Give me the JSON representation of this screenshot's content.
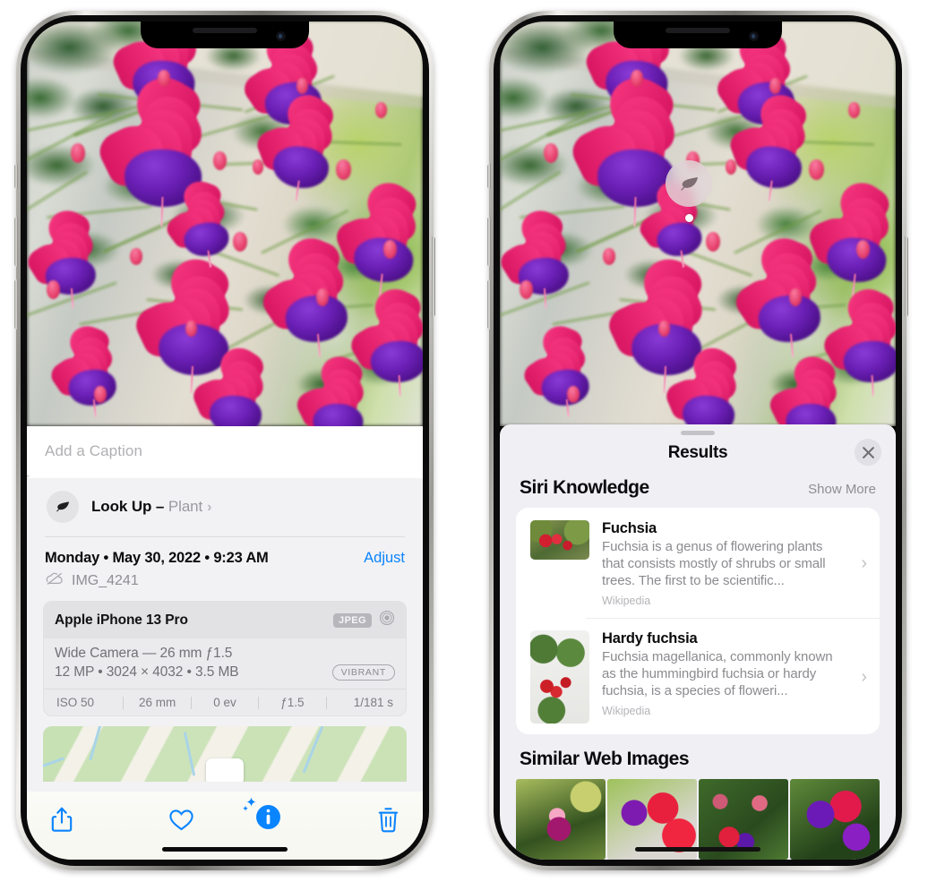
{
  "left_phone": {
    "caption": {
      "placeholder": "Add a Caption",
      "value": ""
    },
    "lookup": {
      "label": "Look Up",
      "dash": " – ",
      "subject": "Plant",
      "icon": "leaf-icon",
      "chevron": "›"
    },
    "details": {
      "date": "Monday • May 30, 2022 • 9:23 AM",
      "adjust_label": "Adjust",
      "filename": "IMG_4241",
      "cloud_icon": "icloud-slash-icon"
    },
    "meta": {
      "model": "Apple iPhone 13 Pro",
      "format_badge": "JPEG",
      "camera_icon": "aperture-icon",
      "lens_line": "Wide Camera — 26 mm ƒ1.5",
      "size_line": "12 MP • 3024 × 4032 • 3.5 MB",
      "style_badge": "VIBRANT",
      "exif": [
        "ISO 50",
        "26 mm",
        "0 ev",
        "ƒ1.5",
        "1/181 s"
      ]
    },
    "toolbar": [
      {
        "name": "share-button",
        "icon": "share-icon"
      },
      {
        "name": "favorite-button",
        "icon": "heart-icon"
      },
      {
        "name": "info-button",
        "icon": "info-sparkle-icon"
      },
      {
        "name": "delete-button",
        "icon": "trash-icon"
      }
    ]
  },
  "right_phone": {
    "badge": {
      "icon": "leaf-icon",
      "name": "visual-lookup-badge"
    },
    "sheet": {
      "title": "Results",
      "close_icon": "close-icon",
      "sections": [
        {
          "title": "Siri Knowledge",
          "action": "Show More",
          "items": [
            {
              "name": "Fuchsia",
              "description": "Fuchsia is a genus of flowering plants that consists mostly of shrubs or small trees. The first to be scientific...",
              "source": "Wikipedia",
              "chevron": "›"
            },
            {
              "name": "Hardy fuchsia",
              "description": "Fuchsia magellanica, commonly known as the hummingbird fuchsia or hardy fuchsia, is a species of floweri...",
              "source": "Wikipedia",
              "chevron": "›"
            }
          ]
        },
        {
          "title": "Similar Web Images",
          "thumbs": 4
        }
      ]
    }
  },
  "colors": {
    "accent_blue": "#0a84ff",
    "sheet_bg": "#f2f2f5",
    "results_bg": "#f0eff4",
    "card_bg": "#ffffff",
    "secondary_text": "#8e8e93"
  }
}
